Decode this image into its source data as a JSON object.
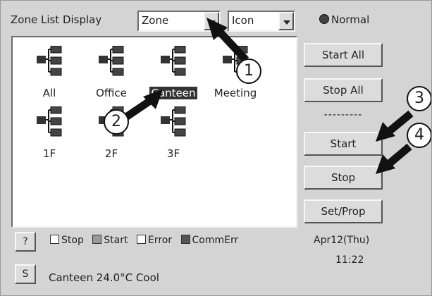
{
  "header": {
    "label": "Zone List Display",
    "zone_select_value": "Zone",
    "view_select_value": "Icon",
    "status_text": "Normal"
  },
  "zones": [
    {
      "label": "All"
    },
    {
      "label": "Office"
    },
    {
      "label": "Canteen",
      "selected": true
    },
    {
      "label": "Meeting"
    },
    {
      "label": "1F"
    },
    {
      "label": "2F"
    },
    {
      "label": "3F"
    }
  ],
  "buttons": {
    "start_all": "Start All",
    "stop_all": "Stop All",
    "separator": "---------",
    "start": "Start",
    "stop": "Stop",
    "set_prop": "Set/Prop",
    "help": "?",
    "s": "S"
  },
  "legend": {
    "stop": "Stop",
    "start": "Start",
    "error": "Error",
    "commerr": "CommErr"
  },
  "status_bar": {
    "text": "Canteen 24.0°C Cool"
  },
  "clock": {
    "date": "Apr12(Thu)",
    "time": "11:22"
  },
  "callouts": [
    "1",
    "2",
    "3",
    "4"
  ],
  "colors": {
    "panel": "#d4d4d4",
    "selected_bg": "#333333",
    "arrow": "#111111"
  }
}
